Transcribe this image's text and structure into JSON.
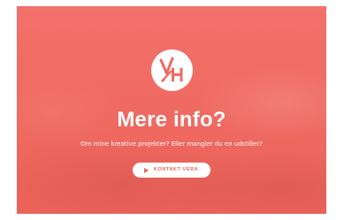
{
  "hero": {
    "logo": {
      "letters": "VH",
      "icon": "vh-paintbrush-monogram-icon",
      "background_color": "#ffffff",
      "mark_color": "#ef6a61"
    },
    "title": "Mere info?",
    "subtitle": "Om mine kreative projekter? Eller mangler du en udstiller?",
    "cta": {
      "label": "KONTAKT VERA",
      "icon": "play-icon"
    },
    "colors": {
      "background": "#f06b62",
      "text": "#ffffff",
      "button_background": "#ffffff",
      "button_text": "#e8655c"
    }
  }
}
